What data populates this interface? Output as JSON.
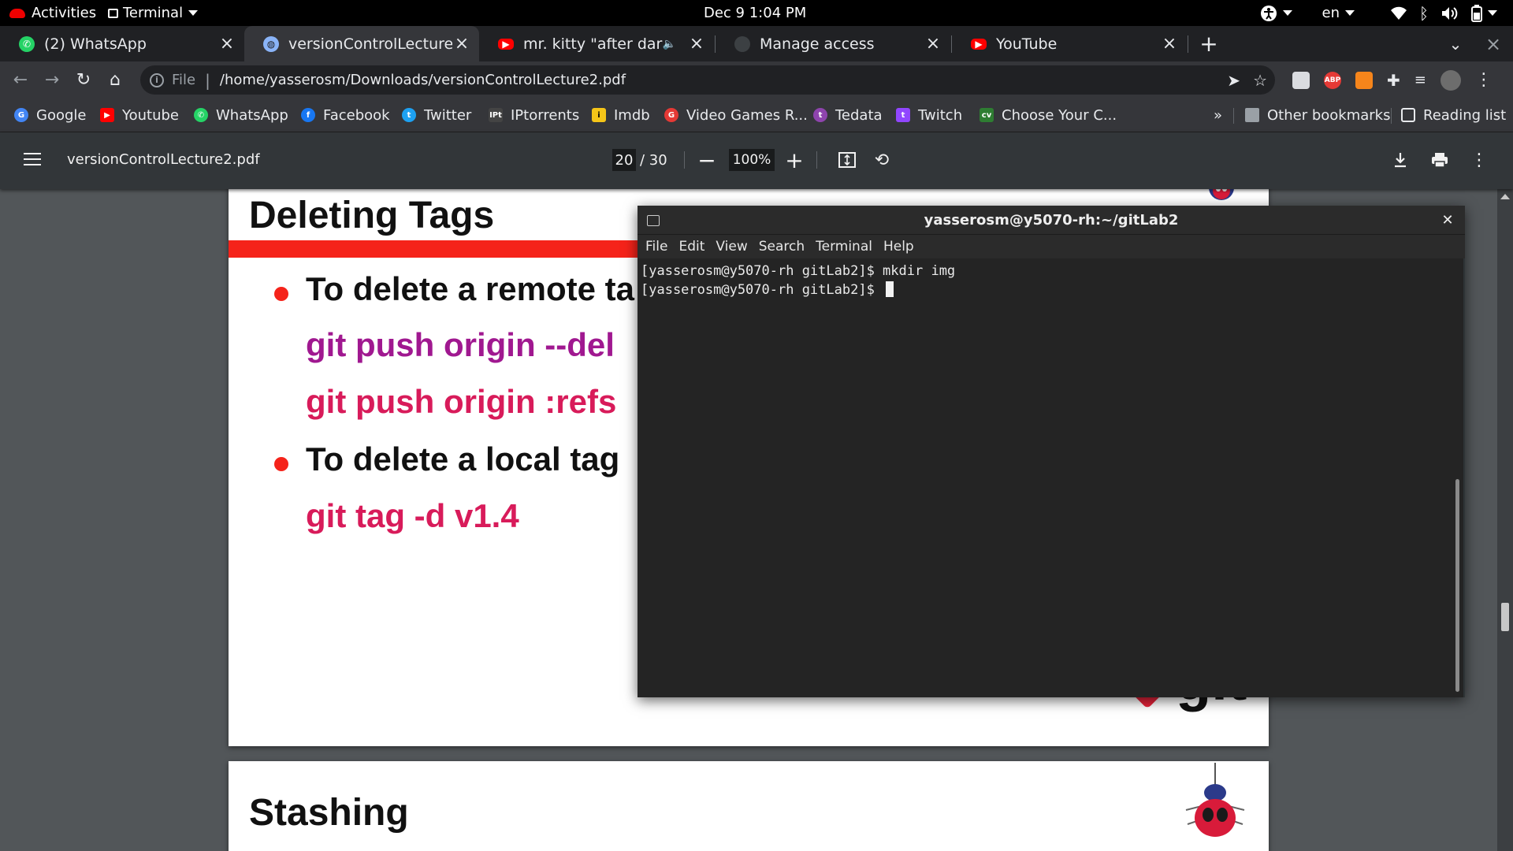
{
  "topbar": {
    "activities": "Activities",
    "app_menu": "Terminal",
    "clock": "Dec 9  1:04 PM",
    "language": "en"
  },
  "tabs": [
    {
      "title": "(2) WhatsApp",
      "favicon": "whatsapp-icon",
      "color": "#25d366"
    },
    {
      "title": "versionControlLecture2.pdf",
      "favicon": "globe-icon",
      "color": "#8ab4f8",
      "active": true
    },
    {
      "title": "mr. kitty \"after dark\" + |",
      "favicon": "youtube-icon",
      "color": "#ff0000",
      "audio": true
    },
    {
      "title": "Manage access",
      "favicon": "github-icon",
      "color": "#3c4043"
    },
    {
      "title": "YouTube",
      "favicon": "youtube-icon",
      "color": "#ff0000"
    }
  ],
  "omnibox": {
    "scheme": "File",
    "url": "/home/yasserosm/Downloads/versionControlLecture2.pdf"
  },
  "extensions": [
    "page-icon",
    "adblock-plus-icon",
    "metamask-icon",
    "puzzle-icon",
    "media-control-icon",
    "profile-avatar"
  ],
  "bookmarks": [
    {
      "label": "Google",
      "icon": "google-icon",
      "color": "#4285f4"
    },
    {
      "label": "Youtube",
      "icon": "youtube-icon",
      "color": "#ff0000"
    },
    {
      "label": "WhatsApp",
      "icon": "whatsapp-icon",
      "color": "#25d366"
    },
    {
      "label": "Facebook",
      "icon": "facebook-icon",
      "color": "#1877f2"
    },
    {
      "label": "Twitter",
      "icon": "twitter-icon",
      "color": "#1da1f2"
    },
    {
      "label": "IPtorrents",
      "icon": "iptorrents-icon",
      "color": "#444444"
    },
    {
      "label": "Imdb",
      "icon": "imdb-icon",
      "color": "#f5c518"
    },
    {
      "label": "Video Games R...",
      "icon": "gamespot-icon",
      "color": "#e53935"
    },
    {
      "label": "Tedata",
      "icon": "tedata-icon",
      "color": "#8e44ad"
    },
    {
      "label": "Twitch",
      "icon": "twitch-icon",
      "color": "#9146ff"
    },
    {
      "label": "Choose Your C...",
      "icon": "cv-icon",
      "color": "#2e7d32"
    }
  ],
  "bookmarks_overflow": "»",
  "other_bookmarks": "Other bookmarks",
  "reading_list": "Reading list",
  "pdf": {
    "filename": "versionControlLecture2.pdf",
    "page_current": "20",
    "page_total": "/ 30",
    "zoom": "100%"
  },
  "slide1": {
    "title": "Deleting Tags",
    "bullet1": "To delete a remote ta",
    "cmd1": "git  push origin  --del",
    "cmd2": "git  push origin :refs",
    "bullet2": "To delete a local tag",
    "cmd3": "git tag -d v1.4",
    "page_number": "20",
    "logo_text": "git"
  },
  "slide2": {
    "title": "Stashing"
  },
  "terminal": {
    "title": "yasserosm@y5070-rh:~/gitLab2",
    "menu": [
      "File",
      "Edit",
      "View",
      "Search",
      "Terminal",
      "Help"
    ],
    "lines": [
      "[yasserosm@y5070-rh gitLab2]$ mkdir img",
      "[yasserosm@y5070-rh gitLab2]$ "
    ]
  },
  "colors": {
    "slide_red": "#f5231a",
    "cmd_purple": "#a01890",
    "cmd_pink": "#d81b5a",
    "chrome_dark": "#202124",
    "chrome_mid": "#35363a"
  }
}
